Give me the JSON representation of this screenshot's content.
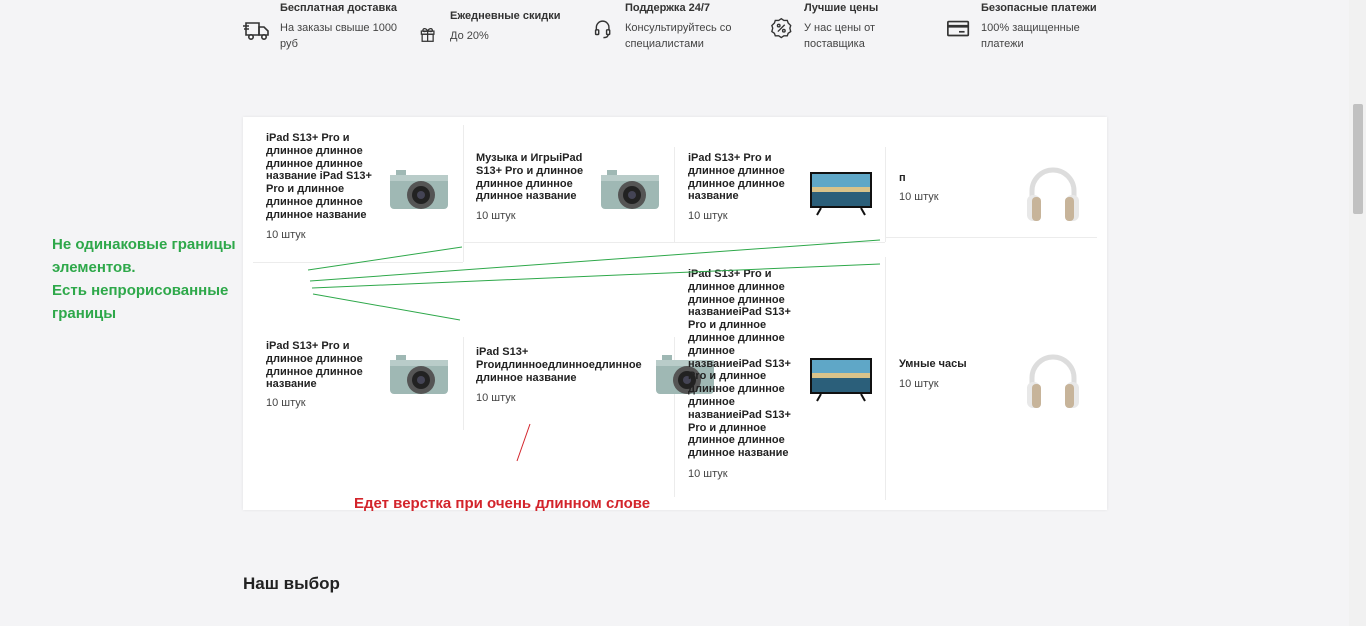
{
  "features": [
    {
      "icon": "truck-icon",
      "title": "Бесплатная доставка",
      "desc_lines": [
        "На заказы свыше 1000",
        "руб"
      ]
    },
    {
      "icon": "gift-icon",
      "title": "Ежедневные скидки",
      "desc_lines": [
        "До 20%"
      ]
    },
    {
      "icon": "headset-icon",
      "title": "Поддержка 24/7",
      "desc_lines": [
        "Консультируйтесь со",
        "специалистами"
      ]
    },
    {
      "icon": "percent-badge-icon",
      "title": "Лучшие цены",
      "desc_lines": [
        "У нас цены от",
        "поставщика"
      ]
    },
    {
      "icon": "credit-card-icon",
      "title": "Безопасные платежи",
      "desc_lines": [
        "100% защищенные",
        "платежи"
      ]
    }
  ],
  "products": [
    {
      "name_lines": [
        "iPad S13+ Pro и",
        "длинное длинное",
        "длинное длинное",
        "название iPad S13+",
        "Pro и длинное",
        "длинное длинное",
        "длинное название"
      ],
      "count": "10 штук",
      "image": "camera-image"
    },
    {
      "name_lines": [
        "Музыка и ИгрыiPad",
        "S13+ Pro и длинное",
        "длинное длинное",
        "длинное название"
      ],
      "count": "10 штук",
      "image": "camera-image"
    },
    {
      "name_lines": [
        "iPad S13+ Pro и",
        "длинное длинное",
        "длинное длинное",
        "название"
      ],
      "count": "10 штук",
      "image": "tv-image"
    },
    {
      "name_lines": [
        "п"
      ],
      "count": "10 штук",
      "image": "headphones-image"
    },
    {
      "name_lines": [
        "iPad S13+ Pro и",
        "длинное длинное",
        "длинное длинное",
        "название"
      ],
      "count": "10 штук",
      "image": "camera-image"
    },
    {
      "name_lines": [
        "iPad S13+",
        "Proидлинноедлинноедлинное",
        "длинное название"
      ],
      "count": "10 штук",
      "image": "camera-image"
    },
    {
      "name_lines": [
        "iPad S13+ Pro и",
        "длинное длинное",
        "длинное длинное",
        "названиеiPad S13+",
        "Pro и длинное",
        "длинное длинное",
        "длинное",
        "названиеiPad S13+",
        "Pro и длинное",
        "длинное длинное",
        "длинное",
        "названиеiPad S13+",
        "Pro и длинное",
        "длинное длинное",
        "длинное название"
      ],
      "count": "10 штук",
      "image": "tv-image"
    },
    {
      "name_lines": [
        "Умные часы"
      ],
      "count": "10 штук",
      "image": "headphones-image"
    }
  ],
  "annotations": {
    "green_lines": [
      "Не одинаковые границы",
      "элементов.",
      "Есть непрорисованные",
      "границы"
    ],
    "red": "Едет верстка при очень длинном слове",
    "green_color": "#2ea84a",
    "red_color": "#d3242b"
  },
  "section_title": "Наш выбор"
}
